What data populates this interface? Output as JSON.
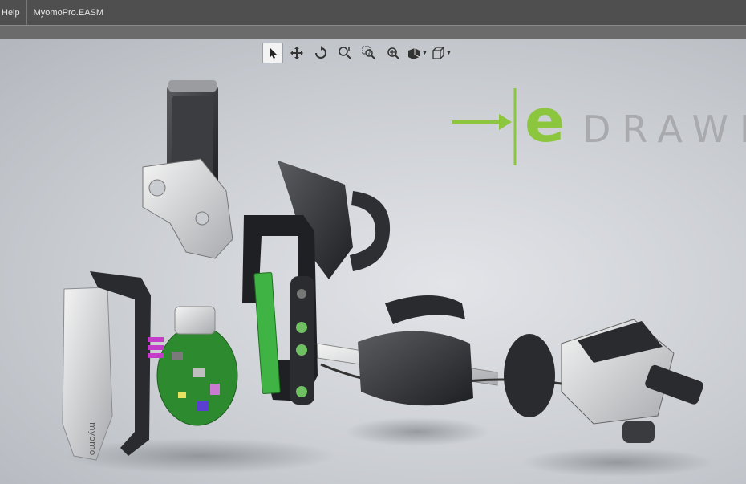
{
  "menu": {
    "help_label": "Help"
  },
  "document": {
    "title": "MyomoPro.EASM"
  },
  "toolbar": {
    "tools": [
      {
        "icon": "select-arrow-icon"
      },
      {
        "icon": "pan-icon"
      },
      {
        "icon": "rotate-icon"
      },
      {
        "icon": "zoom-icon"
      },
      {
        "icon": "zoom-to-area-icon"
      },
      {
        "icon": "zoom-to-fit-icon"
      },
      {
        "icon": "display-style-icon"
      },
      {
        "icon": "view-orientation-icon"
      }
    ]
  },
  "logo": {
    "letter": "e",
    "word": "DRAWI",
    "accent_color": "#8cc63f"
  },
  "device": {
    "brand_label": "myomo"
  }
}
